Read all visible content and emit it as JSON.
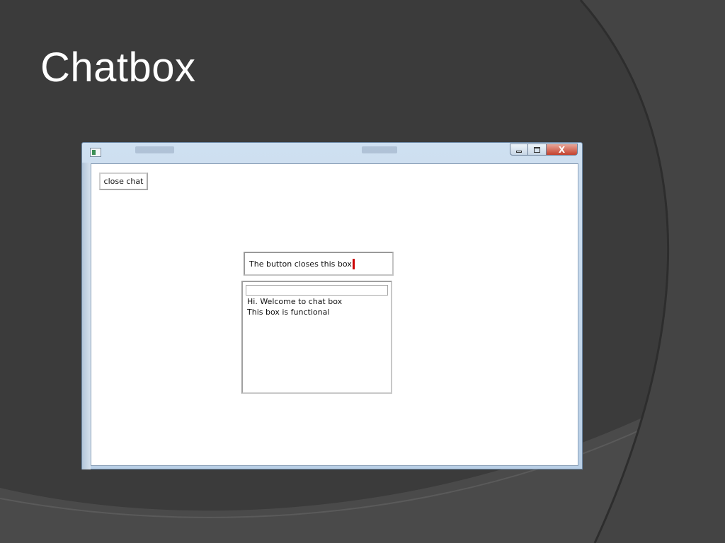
{
  "slide": {
    "title": "Chatbox"
  },
  "window": {
    "controls": {
      "close_glyph": "X"
    },
    "icons": [
      "app-icon",
      "minimize-icon",
      "maximize-icon",
      "close-icon"
    ]
  },
  "app": {
    "close_chat_label": "close chat",
    "message_input_value": "The button closes this box",
    "chat_field_value": "",
    "messages": [
      "Hi. Welcome to chat box",
      "This box is functional"
    ]
  },
  "colors": {
    "slide_background": "#3a3a3a",
    "title_text": "#ffffff",
    "caret": "#cc0000",
    "close_button": "#c4412d"
  }
}
